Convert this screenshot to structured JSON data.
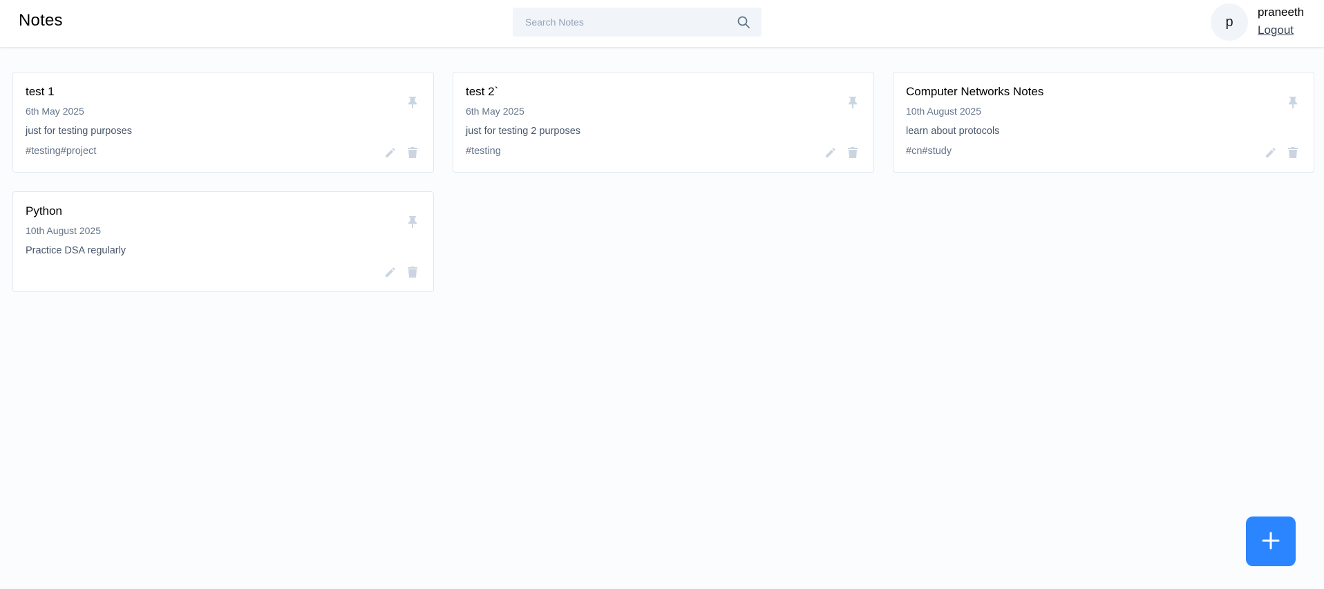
{
  "header": {
    "title": "Notes",
    "search": {
      "placeholder": "Search Notes",
      "value": ""
    },
    "user": {
      "initial": "p",
      "name": "praneeth",
      "logout_label": "Logout"
    }
  },
  "notes": [
    {
      "title": "test 1",
      "date": "6th May 2025",
      "content": "just for testing purposes",
      "tags": "#testing#project"
    },
    {
      "title": "test 2`",
      "date": "6th May 2025",
      "content": "just for testing 2 purposes",
      "tags": "#testing"
    },
    {
      "title": "Computer Networks Notes",
      "date": "10th August 2025",
      "content": "learn about protocols",
      "tags": "#cn#study"
    },
    {
      "title": "Python",
      "date": "10th August 2025",
      "content": "Practice DSA regularly",
      "tags": ""
    }
  ],
  "icons": {
    "pin": "pin-icon",
    "edit": "pencil-icon",
    "delete": "trash-icon",
    "add": "plus-icon",
    "search": "search-icon"
  },
  "colors": {
    "accent": "#2b85ff",
    "icon_muted": "#cbd5e1",
    "background": "#fbfcfe"
  }
}
